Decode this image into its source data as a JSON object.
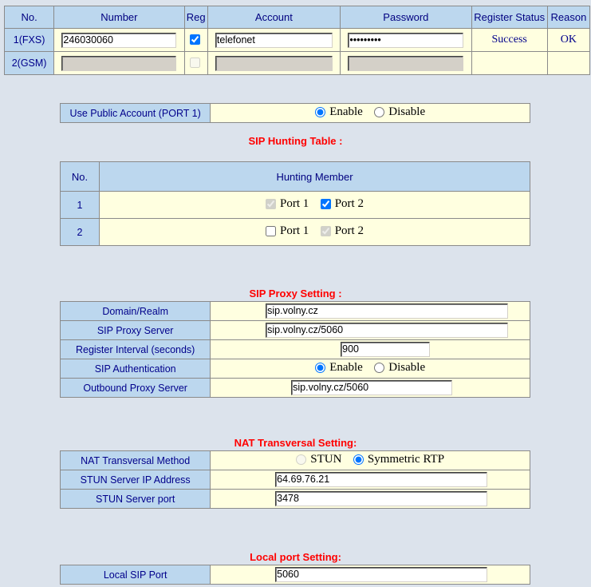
{
  "account_table": {
    "columns": [
      "No.",
      "Number",
      "Reg",
      "Account",
      "Password",
      "Register Status",
      "Reason"
    ],
    "rows": [
      {
        "no": "1(FXS)",
        "number": "246030060",
        "reg_checked": true,
        "reg_disabled": false,
        "account": "telefonet",
        "password": "•••••••••",
        "register_status": "Success",
        "reason": "OK",
        "disabled": false
      },
      {
        "no": "2(GSM)",
        "number": "",
        "reg_checked": false,
        "reg_disabled": true,
        "account": "",
        "password": "",
        "register_status": "",
        "reason": "",
        "disabled": true
      }
    ]
  },
  "public_account": {
    "label": "Use Public Account (PORT 1)",
    "options": [
      "Enable",
      "Disable"
    ],
    "selected": "Enable"
  },
  "hunting": {
    "heading": "SIP Hunting Table :",
    "columns": [
      "No.",
      "Hunting Member"
    ],
    "rows": [
      {
        "no": "1",
        "members": [
          {
            "label": "Port 1",
            "checked": true,
            "disabled": true
          },
          {
            "label": "Port 2",
            "checked": true,
            "disabled": false
          }
        ]
      },
      {
        "no": "2",
        "members": [
          {
            "label": "Port 1",
            "checked": false,
            "disabled": false
          },
          {
            "label": "Port 2",
            "checked": true,
            "disabled": true
          }
        ]
      }
    ]
  },
  "sip_proxy": {
    "heading": "SIP Proxy Setting :",
    "domain_realm_label": "Domain/Realm",
    "domain_realm_value": "sip.volny.cz",
    "proxy_server_label": "SIP Proxy Server",
    "proxy_server_value": "sip.volny.cz/5060",
    "register_interval_label": "Register Interval (seconds)",
    "register_interval_value": "900",
    "authentication_label": "SIP Authentication",
    "authentication_options": [
      "Enable",
      "Disable"
    ],
    "authentication_selected": "Enable",
    "outbound_proxy_label": "Outbound Proxy Server",
    "outbound_proxy_value": "sip.volny.cz/5060"
  },
  "nat": {
    "heading": "NAT Transversal Setting:",
    "method_label": "NAT Transversal Method",
    "method_options": [
      "STUN",
      "Symmetric RTP"
    ],
    "method_selected": "Symmetric RTP",
    "stun_ip_label": "STUN Server IP Address",
    "stun_ip_value": "64.69.76.21",
    "stun_port_label": "STUN Server port",
    "stun_port_value": "3478"
  },
  "local_port": {
    "heading": "Local port Setting:",
    "sip_port_label": "Local SIP Port",
    "sip_port_value": "5060"
  },
  "colors": {
    "page_background": "#dce3ec",
    "header_blue": "#bcd7ee",
    "cell_yellow": "#ffffe0",
    "label_text": "#00008b",
    "heading_red": "#ff0000",
    "disabled_field": "#d4d0c8"
  }
}
